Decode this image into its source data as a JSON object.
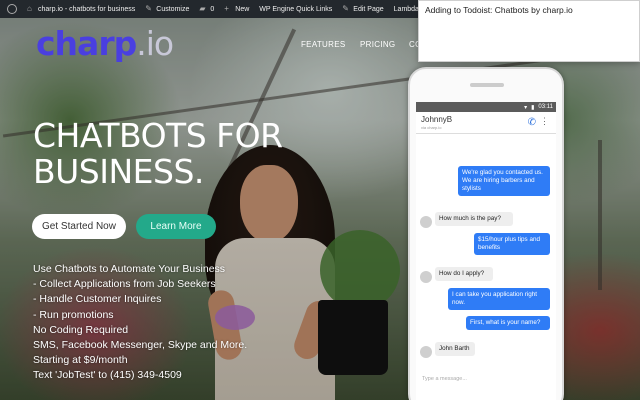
{
  "adminbar": {
    "site_name": "charp.io - chatbots for business",
    "customize": "Customize",
    "comments_count": "0",
    "new_label": "New",
    "wpengine": "WP Engine Quick Links",
    "edit_page": "Edit Page",
    "lambda": "Lambda Them"
  },
  "site": {
    "logo_main": "charp",
    "logo_tld": ".io",
    "nav": [
      "FEATURES",
      "PRICING",
      "CO"
    ]
  },
  "hero": {
    "title_line1": "CHATBOTS FOR",
    "title_line2": "BUSINESS.",
    "cta_primary": "Get Started Now",
    "cta_secondary": "Learn More",
    "features": [
      "Use Chatbots to Automate Your Business",
      "- Collect Applications from Job Seekers",
      "- Handle Customer Inquires",
      "- Run promotions",
      "No Coding Required",
      "SMS, Facebook Messenger, Skype and More.",
      "Starting at $9/month",
      "Text 'JobTest' to (415) 349-4509"
    ]
  },
  "phone": {
    "time": "03:11",
    "contact": "JohnnyB",
    "contact_status": "via charp.io",
    "messages": [
      {
        "dir": "out",
        "text": "We're glad you contacted us. We are hiring barbers and stylists"
      },
      {
        "dir": "in",
        "text": "How much is the pay?"
      },
      {
        "dir": "out",
        "text": "$15/hour plus tips and benefits"
      },
      {
        "dir": "in",
        "text": "How do I apply?"
      },
      {
        "dir": "out",
        "text": "I can take you application right now."
      },
      {
        "dir": "out",
        "text": "First, what is your name?"
      },
      {
        "dir": "in",
        "text": "John Barth"
      }
    ],
    "composer_placeholder": "Type a message..."
  },
  "popup": {
    "text": "Adding to Todoist: Chatbots by charp.io"
  },
  "colors": {
    "brand": "#4a3fe0",
    "adminbar": "#23282d",
    "learn_more": "#23a98a",
    "bubble_out": "#2f7cf6"
  }
}
